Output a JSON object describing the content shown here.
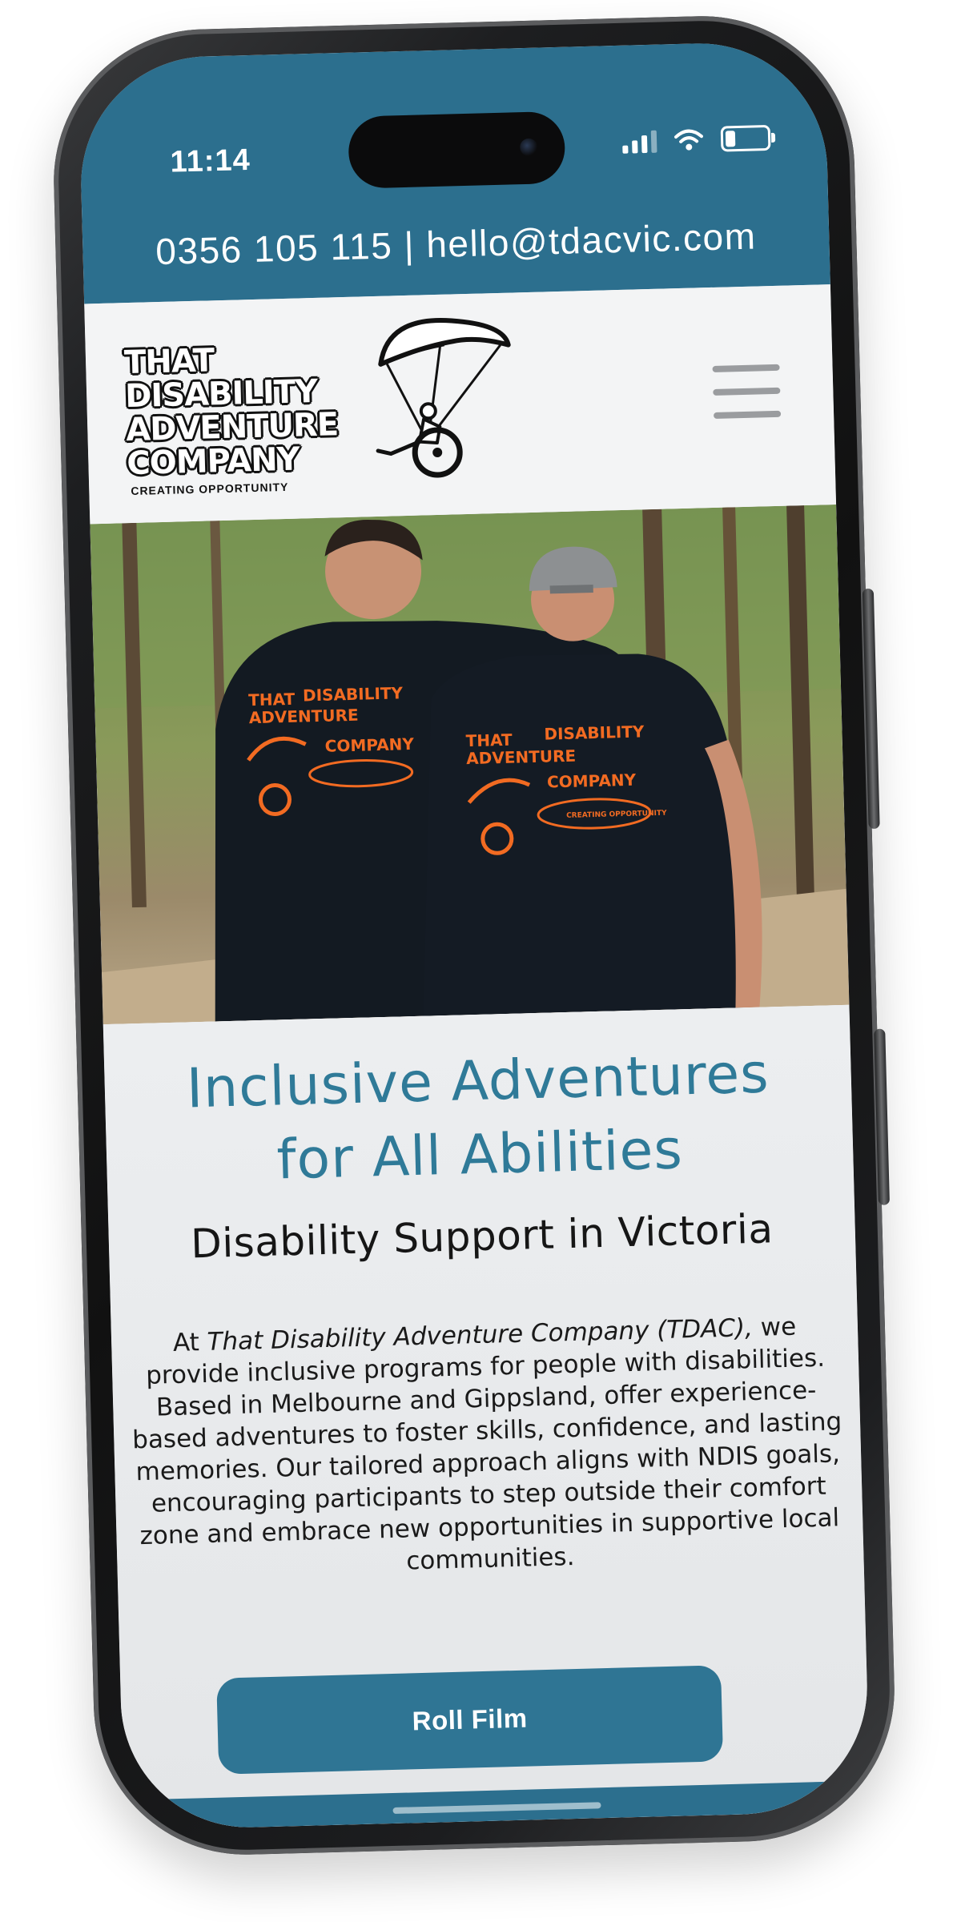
{
  "status_bar": {
    "time": "11:14",
    "icons": [
      "cellular-signal-icon",
      "wifi-icon",
      "battery-icon"
    ]
  },
  "contact_bar": {
    "phone": "0356 105 115",
    "separator": "|",
    "email": "hello@tdacvic.com"
  },
  "header": {
    "logo": {
      "line1": "THAT",
      "line2": "DISABILITY",
      "line3": "ADVENTURE",
      "line4": "COMPANY",
      "tagline": "CREATING OPPORTUNITY",
      "figure": "paraglider-wheelchair-illustration"
    },
    "menu_icon": "hamburger-menu-icon"
  },
  "hero": {
    "image": "two-people-in-tdac-t-shirts-walking-forest-track",
    "shirt_print": {
      "line1": "THAT",
      "line2": "DISABILITY",
      "line3": "ADVENTURE",
      "line4": "COMPANY",
      "tagline": "CREATING OPPORTUNITY"
    }
  },
  "main": {
    "headline_line1": "Inclusive Adventures",
    "headline_line2": "for All Abilities",
    "subheadline": "Disability Support in Victoria",
    "intro": {
      "prefix": "At ",
      "company": "That Disability Adventure Company (TDAC),",
      "body": " we provide inclusive programs for people with disabilities. Based in Melbourne and Gippsland, offer experience-based adventures to foster skills, confidence, and lasting memories. Our tailored approach aligns with NDIS goals, encouraging participants to step outside their comfort zone and embrace new opportunities in supportive local communities."
    },
    "cta_label": "Roll Film"
  },
  "colors": {
    "brand_teal": "#2c6f8e",
    "headline_teal": "#2f7a98",
    "shirt_print_orange": "#f26b22",
    "page_background": "#e9eaec"
  }
}
